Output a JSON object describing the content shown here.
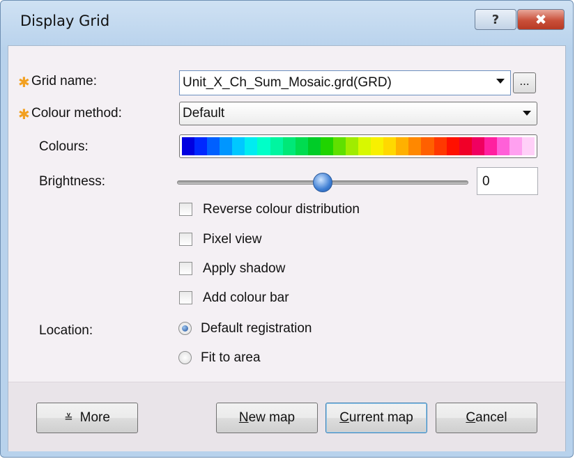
{
  "window": {
    "title": "Display Grid",
    "help_label": "?",
    "close_label": "✖"
  },
  "form": {
    "grid_name": {
      "label": "Grid name:",
      "value": "Unit_X_Ch_Sum_Mosaic.grd(GRD)",
      "browse_label": "..."
    },
    "colour_method": {
      "label": "Colour method:",
      "value": "Default"
    },
    "colours": {
      "label": "Colours:",
      "palette": [
        "#0000e0",
        "#0028ff",
        "#0060ff",
        "#0096ff",
        "#00c8ff",
        "#00ecf0",
        "#00ffc8",
        "#00f5a0",
        "#00e878",
        "#00dc50",
        "#00cc28",
        "#20d400",
        "#60e000",
        "#a0ec00",
        "#d8f800",
        "#f8f000",
        "#ffd800",
        "#ffb000",
        "#ff8800",
        "#ff6000",
        "#ff3800",
        "#ff1000",
        "#f00028",
        "#f00060",
        "#ff20a0",
        "#ff60d8",
        "#ffa0f0",
        "#ffd0f8"
      ]
    },
    "brightness": {
      "label": "Brightness:",
      "value": "0",
      "slider_fraction": 0.5
    },
    "checkboxes": [
      {
        "label": "Reverse colour distribution",
        "checked": false
      },
      {
        "label": "Pixel view",
        "checked": false
      },
      {
        "label": "Apply shadow",
        "checked": false
      },
      {
        "label": "Add colour bar",
        "checked": false
      }
    ],
    "location": {
      "label": "Location:",
      "options": [
        {
          "label": "Default registration",
          "selected": true
        },
        {
          "label": "Fit to area",
          "selected": false
        }
      ]
    }
  },
  "footer": {
    "more_label": "More",
    "more_icon": "double-chevron-down-icon",
    "new_map_mnemonic": "N",
    "new_map_rest": "ew map",
    "current_map_mnemonic": "C",
    "current_map_rest": "urrent map",
    "cancel_mnemonic": "C",
    "cancel_rest": "ancel"
  },
  "colors": {
    "required_star": "#f2a020",
    "client_bg": "#f4f0f4",
    "title_bg": "#b8d2ec"
  }
}
